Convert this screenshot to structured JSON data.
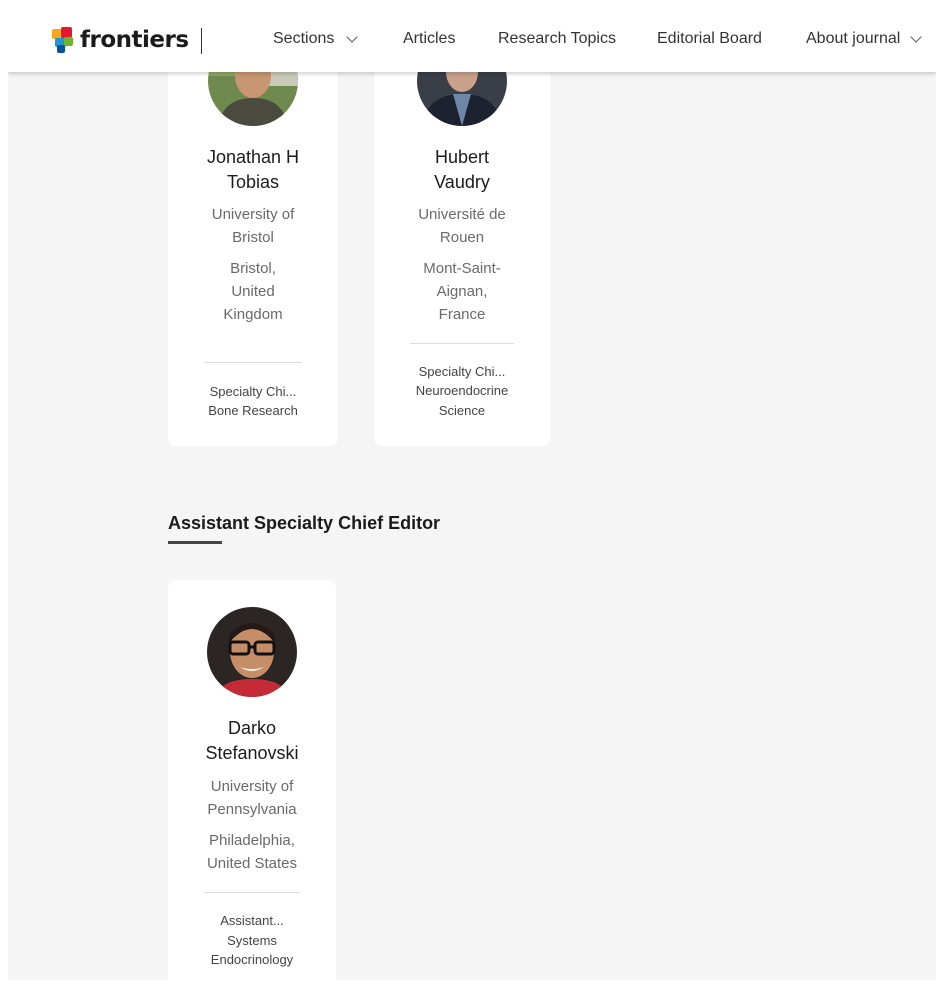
{
  "header": {
    "logo_text": "frontiers",
    "nav": {
      "sections": "Sections",
      "articles": "Articles",
      "research_topics": "Research Topics",
      "editorial_board": "Editorial Board",
      "about_journal": "About journal"
    }
  },
  "editors": [
    {
      "name_line1": "Jonathan H",
      "name_line2": "Tobias",
      "inst_line1": "University of",
      "inst_line2": "Bristol",
      "loc_line1": "Bristol,",
      "loc_line2": "United",
      "loc_line3": "Kingdom",
      "role_line1": "Specialty Chi...",
      "role_line2": "Bone Research"
    },
    {
      "name_line1": "Hubert",
      "name_line2": "Vaudry",
      "inst_line1": "Université de",
      "inst_line2": "Rouen",
      "loc_line1": "Mont-Saint-",
      "loc_line2": "Aignan,",
      "loc_line3": "France",
      "role_line1": "Specialty Chi...",
      "role_line2": "Neuroendocrine",
      "role_line3": "Science"
    }
  ],
  "assistant_section": {
    "title": "Assistant Specialty Chief Editor",
    "editor": {
      "name_line1": "Darko",
      "name_line2": "Stefanovski",
      "inst_line1": "University of",
      "inst_line2": "Pennsylvania",
      "loc_line1": "Philadelphia,",
      "loc_line2": "United States",
      "role_line1": "Assistant...",
      "role_line2": "Systems",
      "role_line3": "Endocrinology"
    }
  }
}
